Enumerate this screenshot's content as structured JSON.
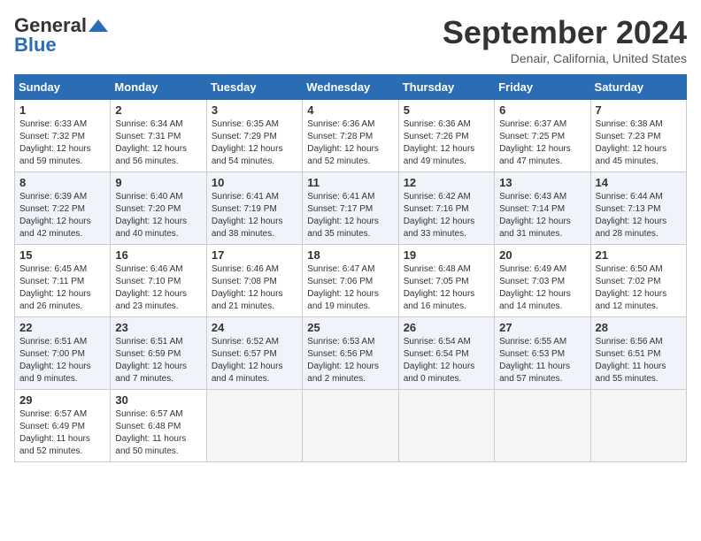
{
  "header": {
    "logo_line1": "General",
    "logo_line2": "Blue",
    "month": "September 2024",
    "location": "Denair, California, United States"
  },
  "columns": [
    "Sunday",
    "Monday",
    "Tuesday",
    "Wednesday",
    "Thursday",
    "Friday",
    "Saturday"
  ],
  "weeks": [
    [
      {
        "day": "1",
        "sunrise": "Sunrise: 6:33 AM",
        "sunset": "Sunset: 7:32 PM",
        "daylight": "Daylight: 12 hours and 59 minutes."
      },
      {
        "day": "2",
        "sunrise": "Sunrise: 6:34 AM",
        "sunset": "Sunset: 7:31 PM",
        "daylight": "Daylight: 12 hours and 56 minutes."
      },
      {
        "day": "3",
        "sunrise": "Sunrise: 6:35 AM",
        "sunset": "Sunset: 7:29 PM",
        "daylight": "Daylight: 12 hours and 54 minutes."
      },
      {
        "day": "4",
        "sunrise": "Sunrise: 6:36 AM",
        "sunset": "Sunset: 7:28 PM",
        "daylight": "Daylight: 12 hours and 52 minutes."
      },
      {
        "day": "5",
        "sunrise": "Sunrise: 6:36 AM",
        "sunset": "Sunset: 7:26 PM",
        "daylight": "Daylight: 12 hours and 49 minutes."
      },
      {
        "day": "6",
        "sunrise": "Sunrise: 6:37 AM",
        "sunset": "Sunset: 7:25 PM",
        "daylight": "Daylight: 12 hours and 47 minutes."
      },
      {
        "day": "7",
        "sunrise": "Sunrise: 6:38 AM",
        "sunset": "Sunset: 7:23 PM",
        "daylight": "Daylight: 12 hours and 45 minutes."
      }
    ],
    [
      {
        "day": "8",
        "sunrise": "Sunrise: 6:39 AM",
        "sunset": "Sunset: 7:22 PM",
        "daylight": "Daylight: 12 hours and 42 minutes."
      },
      {
        "day": "9",
        "sunrise": "Sunrise: 6:40 AM",
        "sunset": "Sunset: 7:20 PM",
        "daylight": "Daylight: 12 hours and 40 minutes."
      },
      {
        "day": "10",
        "sunrise": "Sunrise: 6:41 AM",
        "sunset": "Sunset: 7:19 PM",
        "daylight": "Daylight: 12 hours and 38 minutes."
      },
      {
        "day": "11",
        "sunrise": "Sunrise: 6:41 AM",
        "sunset": "Sunset: 7:17 PM",
        "daylight": "Daylight: 12 hours and 35 minutes."
      },
      {
        "day": "12",
        "sunrise": "Sunrise: 6:42 AM",
        "sunset": "Sunset: 7:16 PM",
        "daylight": "Daylight: 12 hours and 33 minutes."
      },
      {
        "day": "13",
        "sunrise": "Sunrise: 6:43 AM",
        "sunset": "Sunset: 7:14 PM",
        "daylight": "Daylight: 12 hours and 31 minutes."
      },
      {
        "day": "14",
        "sunrise": "Sunrise: 6:44 AM",
        "sunset": "Sunset: 7:13 PM",
        "daylight": "Daylight: 12 hours and 28 minutes."
      }
    ],
    [
      {
        "day": "15",
        "sunrise": "Sunrise: 6:45 AM",
        "sunset": "Sunset: 7:11 PM",
        "daylight": "Daylight: 12 hours and 26 minutes."
      },
      {
        "day": "16",
        "sunrise": "Sunrise: 6:46 AM",
        "sunset": "Sunset: 7:10 PM",
        "daylight": "Daylight: 12 hours and 23 minutes."
      },
      {
        "day": "17",
        "sunrise": "Sunrise: 6:46 AM",
        "sunset": "Sunset: 7:08 PM",
        "daylight": "Daylight: 12 hours and 21 minutes."
      },
      {
        "day": "18",
        "sunrise": "Sunrise: 6:47 AM",
        "sunset": "Sunset: 7:06 PM",
        "daylight": "Daylight: 12 hours and 19 minutes."
      },
      {
        "day": "19",
        "sunrise": "Sunrise: 6:48 AM",
        "sunset": "Sunset: 7:05 PM",
        "daylight": "Daylight: 12 hours and 16 minutes."
      },
      {
        "day": "20",
        "sunrise": "Sunrise: 6:49 AM",
        "sunset": "Sunset: 7:03 PM",
        "daylight": "Daylight: 12 hours and 14 minutes."
      },
      {
        "day": "21",
        "sunrise": "Sunrise: 6:50 AM",
        "sunset": "Sunset: 7:02 PM",
        "daylight": "Daylight: 12 hours and 12 minutes."
      }
    ],
    [
      {
        "day": "22",
        "sunrise": "Sunrise: 6:51 AM",
        "sunset": "Sunset: 7:00 PM",
        "daylight": "Daylight: 12 hours and 9 minutes."
      },
      {
        "day": "23",
        "sunrise": "Sunrise: 6:51 AM",
        "sunset": "Sunset: 6:59 PM",
        "daylight": "Daylight: 12 hours and 7 minutes."
      },
      {
        "day": "24",
        "sunrise": "Sunrise: 6:52 AM",
        "sunset": "Sunset: 6:57 PM",
        "daylight": "Daylight: 12 hours and 4 minutes."
      },
      {
        "day": "25",
        "sunrise": "Sunrise: 6:53 AM",
        "sunset": "Sunset: 6:56 PM",
        "daylight": "Daylight: 12 hours and 2 minutes."
      },
      {
        "day": "26",
        "sunrise": "Sunrise: 6:54 AM",
        "sunset": "Sunset: 6:54 PM",
        "daylight": "Daylight: 12 hours and 0 minutes."
      },
      {
        "day": "27",
        "sunrise": "Sunrise: 6:55 AM",
        "sunset": "Sunset: 6:53 PM",
        "daylight": "Daylight: 11 hours and 57 minutes."
      },
      {
        "day": "28",
        "sunrise": "Sunrise: 6:56 AM",
        "sunset": "Sunset: 6:51 PM",
        "daylight": "Daylight: 11 hours and 55 minutes."
      }
    ],
    [
      {
        "day": "29",
        "sunrise": "Sunrise: 6:57 AM",
        "sunset": "Sunset: 6:49 PM",
        "daylight": "Daylight: 11 hours and 52 minutes."
      },
      {
        "day": "30",
        "sunrise": "Sunrise: 6:57 AM",
        "sunset": "Sunset: 6:48 PM",
        "daylight": "Daylight: 11 hours and 50 minutes."
      },
      null,
      null,
      null,
      null,
      null
    ]
  ]
}
